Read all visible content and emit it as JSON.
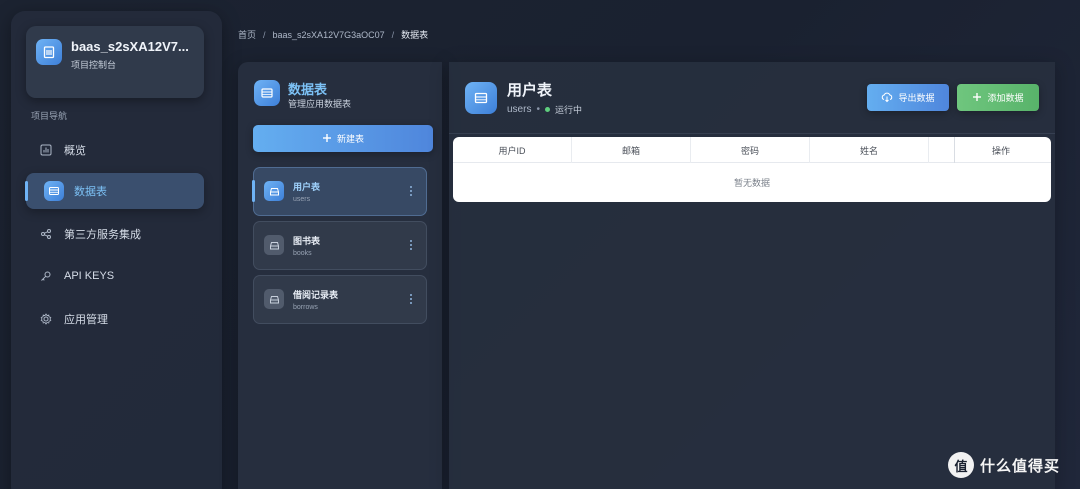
{
  "sidebar": {
    "project_name": "baas_s2sXA12V7...",
    "project_subtitle": "项目控制台",
    "nav_heading": "项目导航",
    "items": [
      {
        "label": "概览",
        "icon": "bar-chart-icon"
      },
      {
        "label": "数据表",
        "icon": "table-icon"
      },
      {
        "label": "第三方服务集成",
        "icon": "share-icon"
      },
      {
        "label": "API KEYS",
        "icon": "key-icon"
      },
      {
        "label": "应用管理",
        "icon": "gear-icon"
      }
    ],
    "active_item": "数据表"
  },
  "breadcrumb": {
    "home": "首页",
    "project": "baas_s2sXA12V7G3aOC07",
    "current": "数据表",
    "separator": "/"
  },
  "tables_panel": {
    "title": "数据表",
    "subtitle": "管理应用数据表",
    "new_table_label": "新建表",
    "tables": [
      {
        "name": "用户表",
        "key": "users",
        "active": true
      },
      {
        "name": "图书表",
        "key": "books",
        "active": false
      },
      {
        "name": "借阅记录表",
        "key": "borrows",
        "active": false
      }
    ]
  },
  "main": {
    "title": "用户表",
    "table_key": "users",
    "separator_dot": "•",
    "status": "运行中",
    "export_label": "导出数据",
    "add_label": "添加数据",
    "columns": [
      "用户ID",
      "邮箱",
      "密码",
      "姓名",
      "",
      "操作"
    ],
    "empty_text": "暂无数据"
  },
  "watermark": {
    "logo_char": "值",
    "text": "什么值得买"
  },
  "colors": {
    "accent": "#6fb3f5",
    "success": "#5fcf7e",
    "add_button": "#6fc67e",
    "background": "#1c2331"
  }
}
